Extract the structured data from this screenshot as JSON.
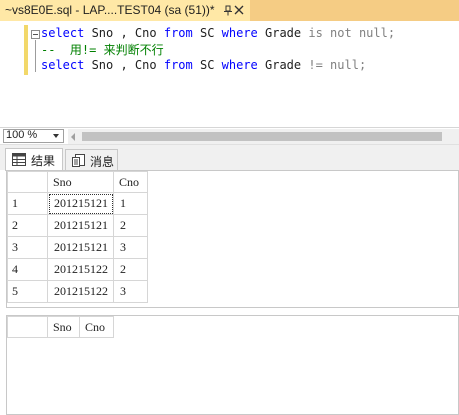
{
  "document_tab": {
    "title": "~vs8E0E.sql - LAP....TEST04 (sa (51))*"
  },
  "editor": {
    "line1": {
      "kw_select": "select",
      "part_cols": " Sno , Cno ",
      "kw_from": "from",
      "part_table": " SC ",
      "kw_where": "where",
      "part_field": " Grade ",
      "kw_is": "is",
      "kw_not": " not",
      "kw_null": " null",
      "semicolon": ";"
    },
    "line2": {
      "comment": "--  用!= 来判断不行"
    },
    "line3": {
      "kw_select": "select",
      "part_cols": " Sno , Cno ",
      "kw_from": "from",
      "part_table": " SC ",
      "kw_where": "where",
      "part_field": " Grade ",
      "op": "!=",
      "kw_null": " null",
      "semicolon": ";"
    }
  },
  "zoom": {
    "value": "100 %"
  },
  "results_tabs": {
    "results_label": "结果",
    "messages_label": "消息"
  },
  "result_grid_1": {
    "headers": [
      "Sno",
      "Cno"
    ],
    "rows": [
      {
        "num": "1",
        "sno": "201215121",
        "cno": "1"
      },
      {
        "num": "2",
        "sno": "201215121",
        "cno": "2"
      },
      {
        "num": "3",
        "sno": "201215121",
        "cno": "3"
      },
      {
        "num": "4",
        "sno": "201215122",
        "cno": "2"
      },
      {
        "num": "5",
        "sno": "201215122",
        "cno": "3"
      }
    ]
  },
  "result_grid_2": {
    "headers": [
      "Sno",
      "Cno"
    ]
  },
  "colors": {
    "tab_active": "#ffe8a6",
    "tab_bar": "#f5cc84",
    "keyword": "#0000ff",
    "comment": "#008000",
    "operator_gray": "#808080"
  }
}
